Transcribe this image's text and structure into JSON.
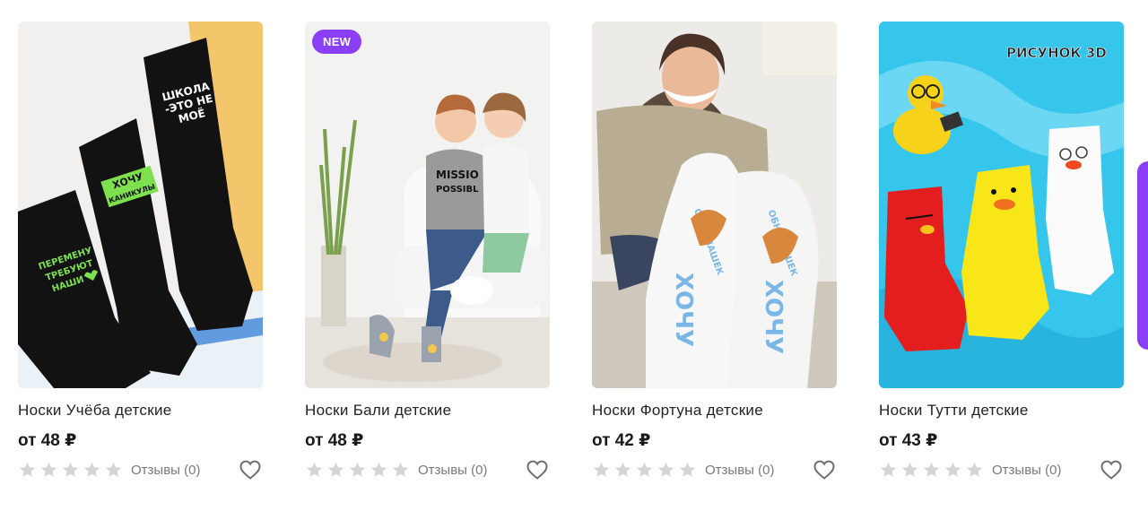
{
  "products": [
    {
      "title": "Носки Учёба детские",
      "price": "от 48 ₽",
      "reviews": "Отзывы (0)",
      "rating": 0,
      "badge": null,
      "sock_texts": [
        "ШКОЛА",
        "-ЭТО НЕ",
        "МОЁ",
        "ХОЧУ",
        "КАНИКУЛЫ",
        "ПЕРЕМЕНУ",
        "ТРЕБУЮТ",
        "НАШИ"
      ]
    },
    {
      "title": "Носки Бали детские",
      "price": "от 48 ₽",
      "reviews": "Отзывы (0)",
      "rating": 0,
      "badge": "NEW",
      "shirt_texts": [
        "MISSIO",
        "POSSIBL"
      ]
    },
    {
      "title": "Носки Фортуна детские",
      "price": "от 42 ₽",
      "reviews": "Отзывы (0)",
      "rating": 0,
      "badge": null,
      "sock_texts": [
        "ХОЧУ",
        "ОБНИМАШЕК"
      ]
    },
    {
      "title": "Носки Тутти детские",
      "price": "от 43 ₽",
      "reviews": "Отзывы (0)",
      "rating": 0,
      "badge": null,
      "corner_label": "РИСУНОК 3D"
    }
  ],
  "colors": {
    "accent": "#8a3ff7",
    "star_empty": "#d6d6d6",
    "text_muted": "#7a7a7a"
  },
  "icons": {
    "rating": "star-icon",
    "favorite": "heart-icon"
  }
}
